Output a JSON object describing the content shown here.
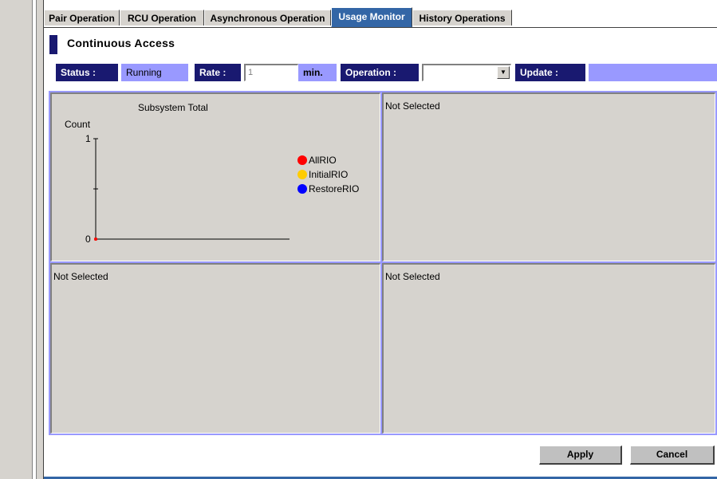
{
  "tabs": [
    {
      "label": "Pair Operation",
      "active": false
    },
    {
      "label": "RCU Operation",
      "active": false
    },
    {
      "label": "Asynchronous Operation",
      "active": false
    },
    {
      "label": "Usage Monitor",
      "active": true
    },
    {
      "label": "History Operations",
      "active": false
    }
  ],
  "title": "Continuous Access",
  "status": {
    "status_label": "Status :",
    "status_value": "Running",
    "rate_label": "Rate :",
    "rate_value": "1",
    "rate_unit": "min.",
    "operation_label": "Operation :",
    "operation_value": "",
    "update_label": "Update :",
    "update_value": ""
  },
  "graphs": [
    {
      "label": "Subsystem Total"
    },
    {
      "label": "Not Selected"
    },
    {
      "label": "Not Selected"
    },
    {
      "label": "Not Selected"
    }
  ],
  "chart_data": {
    "type": "line",
    "title": "Subsystem Total",
    "ylabel": "Count",
    "xlabel": "",
    "ylim": [
      0,
      1
    ],
    "yticks": [
      "1",
      "0"
    ],
    "series": [
      {
        "name": "AllRIO",
        "color": "#ff0000",
        "values": [
          0
        ]
      },
      {
        "name": "InitialRIO",
        "color": "#ffcc00",
        "values": [
          0
        ]
      },
      {
        "name": "RestoreRIO",
        "color": "#0000ff",
        "values": [
          0
        ]
      }
    ]
  },
  "buttons": {
    "apply": "Apply",
    "cancel": "Cancel"
  },
  "colors": {
    "accent": "#3366a6",
    "label_dark": "#191970",
    "label_light": "#9999ff",
    "panel_gray": "#d6d3ce"
  }
}
